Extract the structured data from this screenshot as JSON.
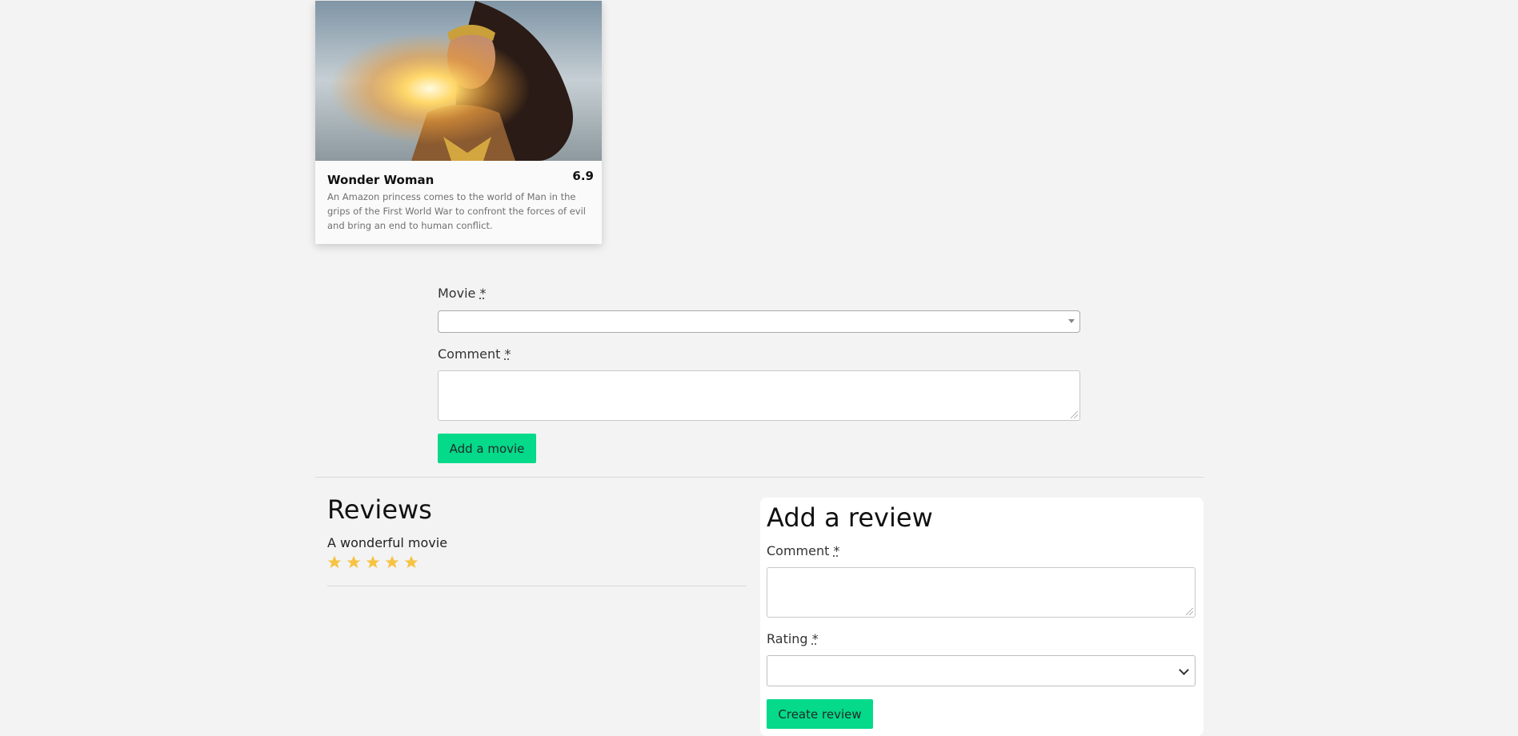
{
  "movie_card": {
    "title": "Wonder Woman",
    "score": "6.9",
    "description": "An Amazon princess comes to the world of Man in the grips of the First World War to confront the forces of evil and bring an end to human conflict."
  },
  "movie_form": {
    "movie_label": "Movie",
    "comment_label": "Comment",
    "required_mark": "*",
    "movie_value": "",
    "comment_value": "",
    "submit_label": "Add a movie"
  },
  "reviews": {
    "heading": "Reviews",
    "items": [
      {
        "text": "A wonderful movie",
        "rating": 5
      }
    ]
  },
  "review_form": {
    "heading": "Add a review",
    "comment_label": "Comment",
    "rating_label": "Rating",
    "required_mark": "*",
    "comment_value": "",
    "rating_value": "",
    "submit_label": "Create review"
  },
  "colors": {
    "accent": "#05d98a",
    "star": "#f6c343",
    "background": "#f3f3f3"
  }
}
